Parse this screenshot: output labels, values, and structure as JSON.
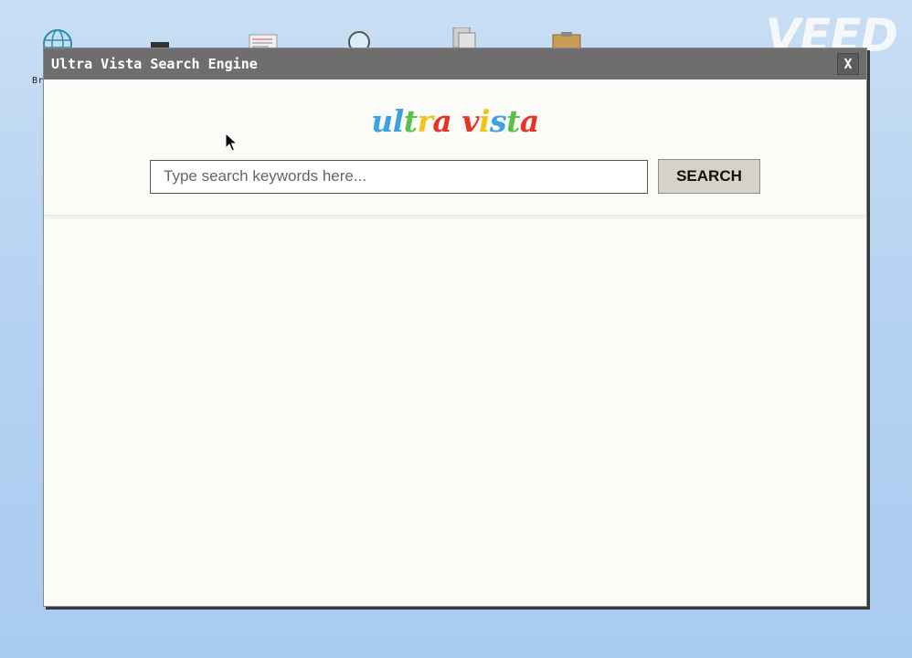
{
  "desktop": {
    "icons": [
      {
        "name": "globe-icon"
      },
      {
        "name": "monitor-icon"
      },
      {
        "name": "notepad-icon"
      },
      {
        "name": "magnifier-icon"
      },
      {
        "name": "documents-icon"
      },
      {
        "name": "clipboard-icon"
      }
    ],
    "first_label": "Br"
  },
  "watermark": {
    "text": "VEED"
  },
  "window": {
    "title": "Ultra Vista Search Engine",
    "close_label": "X"
  },
  "logo": {
    "letters": [
      {
        "char": "u",
        "color": "#3ba0e4"
      },
      {
        "char": "l",
        "color": "#3ba0e4"
      },
      {
        "char": "t",
        "color": "#5bc04b"
      },
      {
        "char": "r",
        "color": "#f0c419"
      },
      {
        "char": "a",
        "color": "#e8332a"
      },
      {
        "char": " ",
        "color": "#000000"
      },
      {
        "char": "v",
        "color": "#e8332a"
      },
      {
        "char": "i",
        "color": "#f0c419"
      },
      {
        "char": "s",
        "color": "#3ba0e4"
      },
      {
        "char": "t",
        "color": "#5bc04b"
      },
      {
        "char": "a",
        "color": "#e8332a"
      }
    ]
  },
  "search": {
    "placeholder": "Type search keywords here...",
    "value": "",
    "button_label": "SEARCH"
  }
}
